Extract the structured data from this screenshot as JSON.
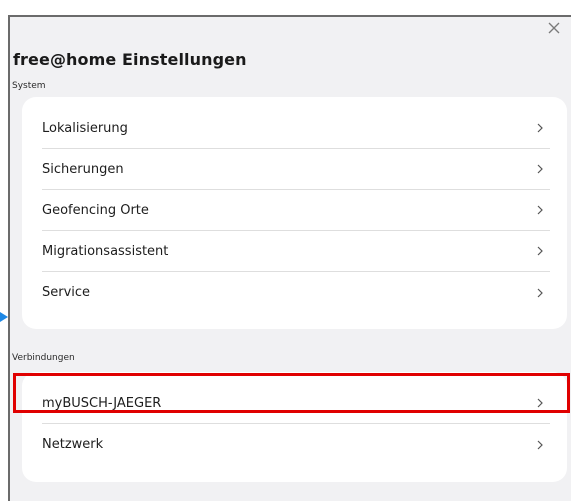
{
  "dialog": {
    "title": "free@home Einstellungen",
    "close_icon": "close-icon"
  },
  "sections": [
    {
      "label": "System",
      "items": [
        {
          "label": "Lokalisierung"
        },
        {
          "label": "Sicherungen"
        },
        {
          "label": "Geofencing Orte"
        },
        {
          "label": "Migrationsassistent"
        },
        {
          "label": "Service"
        }
      ]
    },
    {
      "label": "Verbindungen",
      "items": [
        {
          "label": "myBUSCH-JAEGER",
          "highlighted": true
        },
        {
          "label": "Netzwerk"
        }
      ]
    }
  ],
  "colors": {
    "background": "#f1f1f3",
    "card": "#ffffff",
    "highlight": "#e00000",
    "marker": "#1e88e5"
  }
}
